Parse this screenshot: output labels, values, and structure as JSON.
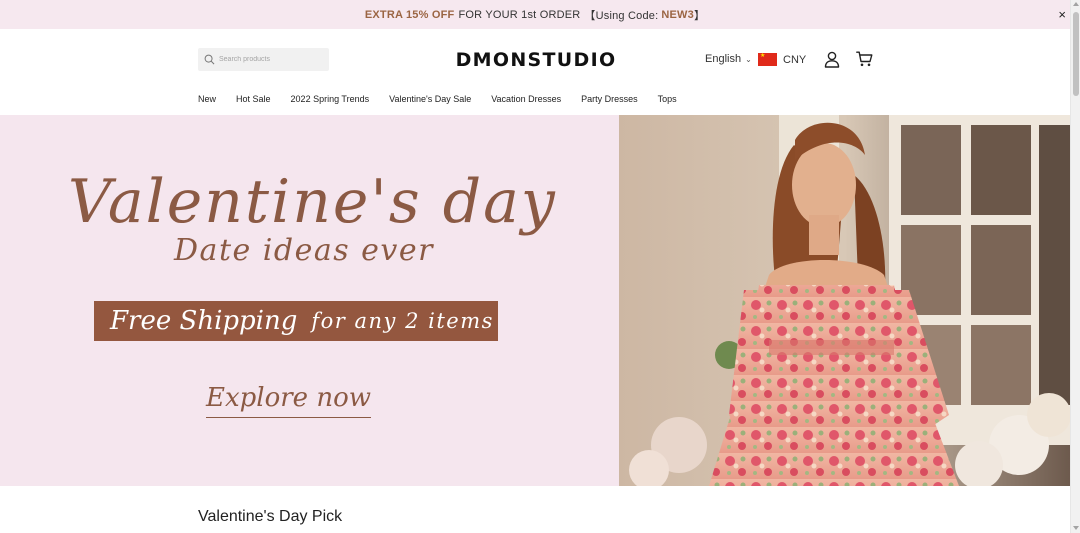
{
  "announcement": {
    "highlight": "EXTRA 15% OFF",
    "text": "FOR YOUR 1st ORDER",
    "code_prefix": "【Using Code:",
    "code": "NEW3",
    "code_suffix": "】",
    "close_icon": "close-icon",
    "close_glyph": "×"
  },
  "header": {
    "search_placeholder": "Search products",
    "logo": "DMONSTUDIO",
    "language": "English",
    "currency": "CNY",
    "flag": "china-flag-icon",
    "account_icon": "user-icon",
    "cart_icon": "cart-icon"
  },
  "nav": {
    "items": [
      {
        "label": "New"
      },
      {
        "label": "Hot Sale"
      },
      {
        "label": "2022 Spring Trends"
      },
      {
        "label": "Valentine's Day Sale"
      },
      {
        "label": "Vacation Dresses"
      },
      {
        "label": "Party Dresses"
      },
      {
        "label": "Tops"
      }
    ]
  },
  "hero": {
    "title": "Valentine's day",
    "subtitle": "Date ideas ever",
    "shipping_main": "Free Shipping",
    "shipping_rest": "for any 2 items",
    "cta": "Explore now",
    "background_color": "#f5e6ee",
    "accent_color": "#8b5a44"
  },
  "section": {
    "title": "Valentine's Day Pick"
  },
  "colors": {
    "announcement_bg": "#f6e8ef",
    "announcement_accent": "#9b6543",
    "shipping_box": "#94573f"
  }
}
